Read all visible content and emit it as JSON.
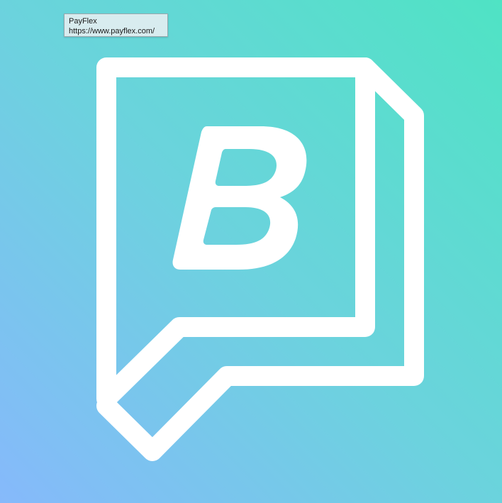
{
  "tooltip": {
    "title": "PayFlex",
    "url": "https://www.payflex.com/"
  },
  "logo": {
    "icon": "speech-bubble-b-icon",
    "color": "#ffffff"
  },
  "colors": {
    "gradient_start": "#86b9fb",
    "gradient_mid": "#6bd3dd",
    "gradient_end": "#4fe3c4",
    "tooltip_bg": "#d8ecef"
  }
}
